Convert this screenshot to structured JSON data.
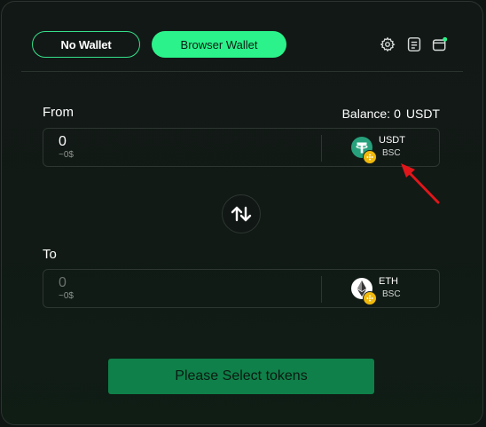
{
  "tabs": {
    "no_wallet": "No Wallet",
    "browser_wallet": "Browser Wallet"
  },
  "top_icons": [
    "settings-icon",
    "history-icon",
    "wallet-icon"
  ],
  "from": {
    "label": "From",
    "balance_label": "Balance:",
    "balance_value": "0",
    "balance_unit": "USDT",
    "amount": "0",
    "usd_value": "~0$",
    "token_symbol": "USDT",
    "token_network": "BSC"
  },
  "to": {
    "label": "To",
    "amount": "0",
    "usd_value": "~0$",
    "token_symbol": "ETH",
    "token_network": "BSC"
  },
  "cta_label": "Please Select tokens",
  "colors": {
    "accent": "#2bf28a",
    "cta_bg": "#0f8049",
    "annotation_arrow": "#e0161b",
    "usdt": "#26a17b",
    "bnb": "#f0b90b"
  }
}
